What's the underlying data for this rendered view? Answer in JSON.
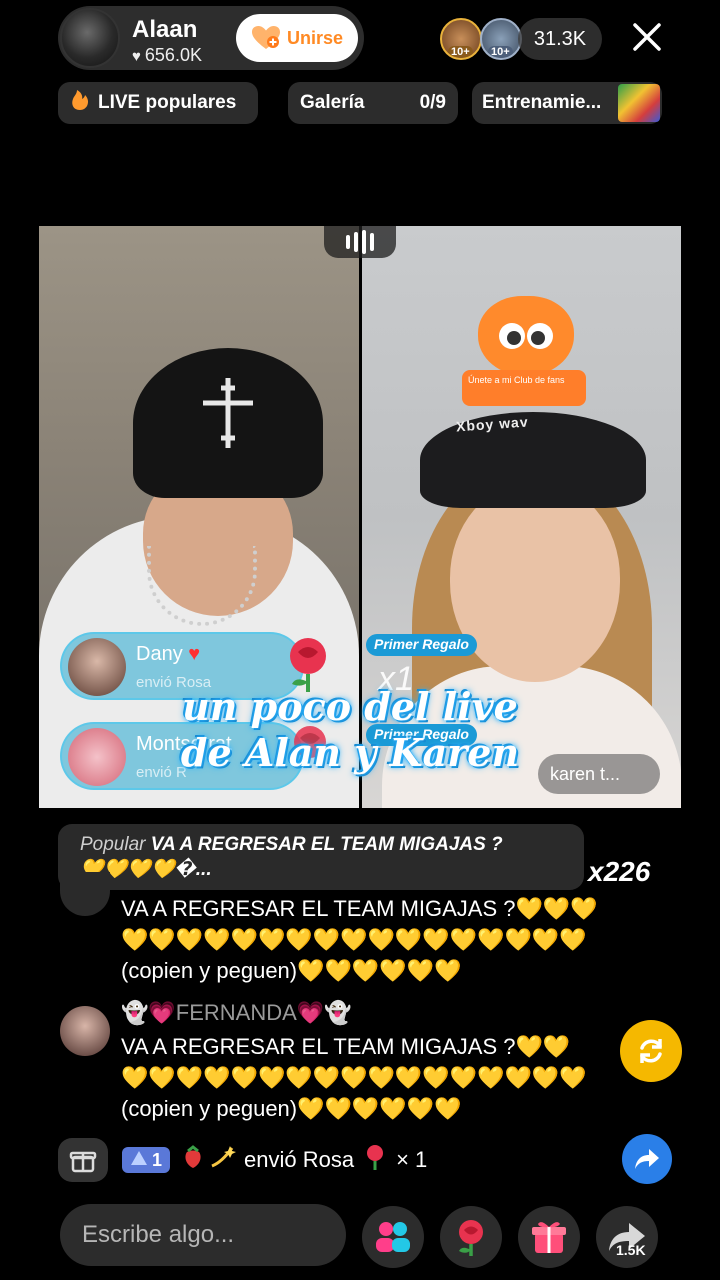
{
  "header": {
    "host_name": "Alaan",
    "host_likes": "656.0K",
    "join_label": "Unirse",
    "viewer_badges": [
      "10+",
      "10+"
    ],
    "viewer_count": "31.3K"
  },
  "chips": {
    "live_popular": "LIVE populares",
    "gallery_label": "Galería",
    "gallery_count": "0/9",
    "training_label": "Entrenamie..."
  },
  "video": {
    "cap_text": "Xboy wav",
    "club_sticker_text": "Únete a mi Club de fans",
    "gifts": [
      {
        "name": "Dany",
        "sub": "envió Rosa"
      },
      {
        "name": "Montserrat",
        "sub": "envió R"
      }
    ],
    "first_gift_label": "Primer Regalo",
    "x1": "x1",
    "karen_tag": "karen t...",
    "caption_line1": "un poco del live",
    "caption_line2": "de Alan y Karen"
  },
  "chat": {
    "popular_tag": "Popular",
    "popular_text": "VA A REGRESAR EL TEAM MIGAJAS ?",
    "popular_hearts": "💛💛💛💛�...",
    "popular_multiplier": "x226",
    "msg1_line1": "VA A REGRESAR EL TEAM MIGAJAS ?💛💛💛",
    "msg1_line2": "💛💛💛💛💛💛💛💛💛💛💛💛💛💛💛💛💛",
    "msg1_line3": "(copien y peguen)💛💛💛💛💛💛",
    "msg2_user": "👻💗FERNANDA💗👻",
    "msg2_line1": "VA A REGRESAR EL TEAM MIGAJAS ?💛💛",
    "msg2_line2": "💛💛💛💛💛💛💛💛💛💛💛💛💛💛💛💛💛",
    "msg2_line3": "(copien y peguen)💛💛💛💛💛💛"
  },
  "gift_row": {
    "level": "1",
    "text": "envió Rosa",
    "count": "× 1"
  },
  "bottom": {
    "input_placeholder": "Escribe algo...",
    "share_count": "1.5K"
  },
  "colors": {
    "accent_orange": "#ff8a24",
    "gift_pill_blue": "#26aad2",
    "first_gift_blue": "#1b9ad6",
    "refresh_yellow": "#f5b800",
    "share_blue": "#2a7fe8"
  },
  "icons": [
    "heart-icon",
    "join-heart-icon",
    "close-icon",
    "flame-icon",
    "rose-icon",
    "gift-icon",
    "share-arrow-icon",
    "refresh-icon",
    "people-icon",
    "level-arrow-icon"
  ]
}
